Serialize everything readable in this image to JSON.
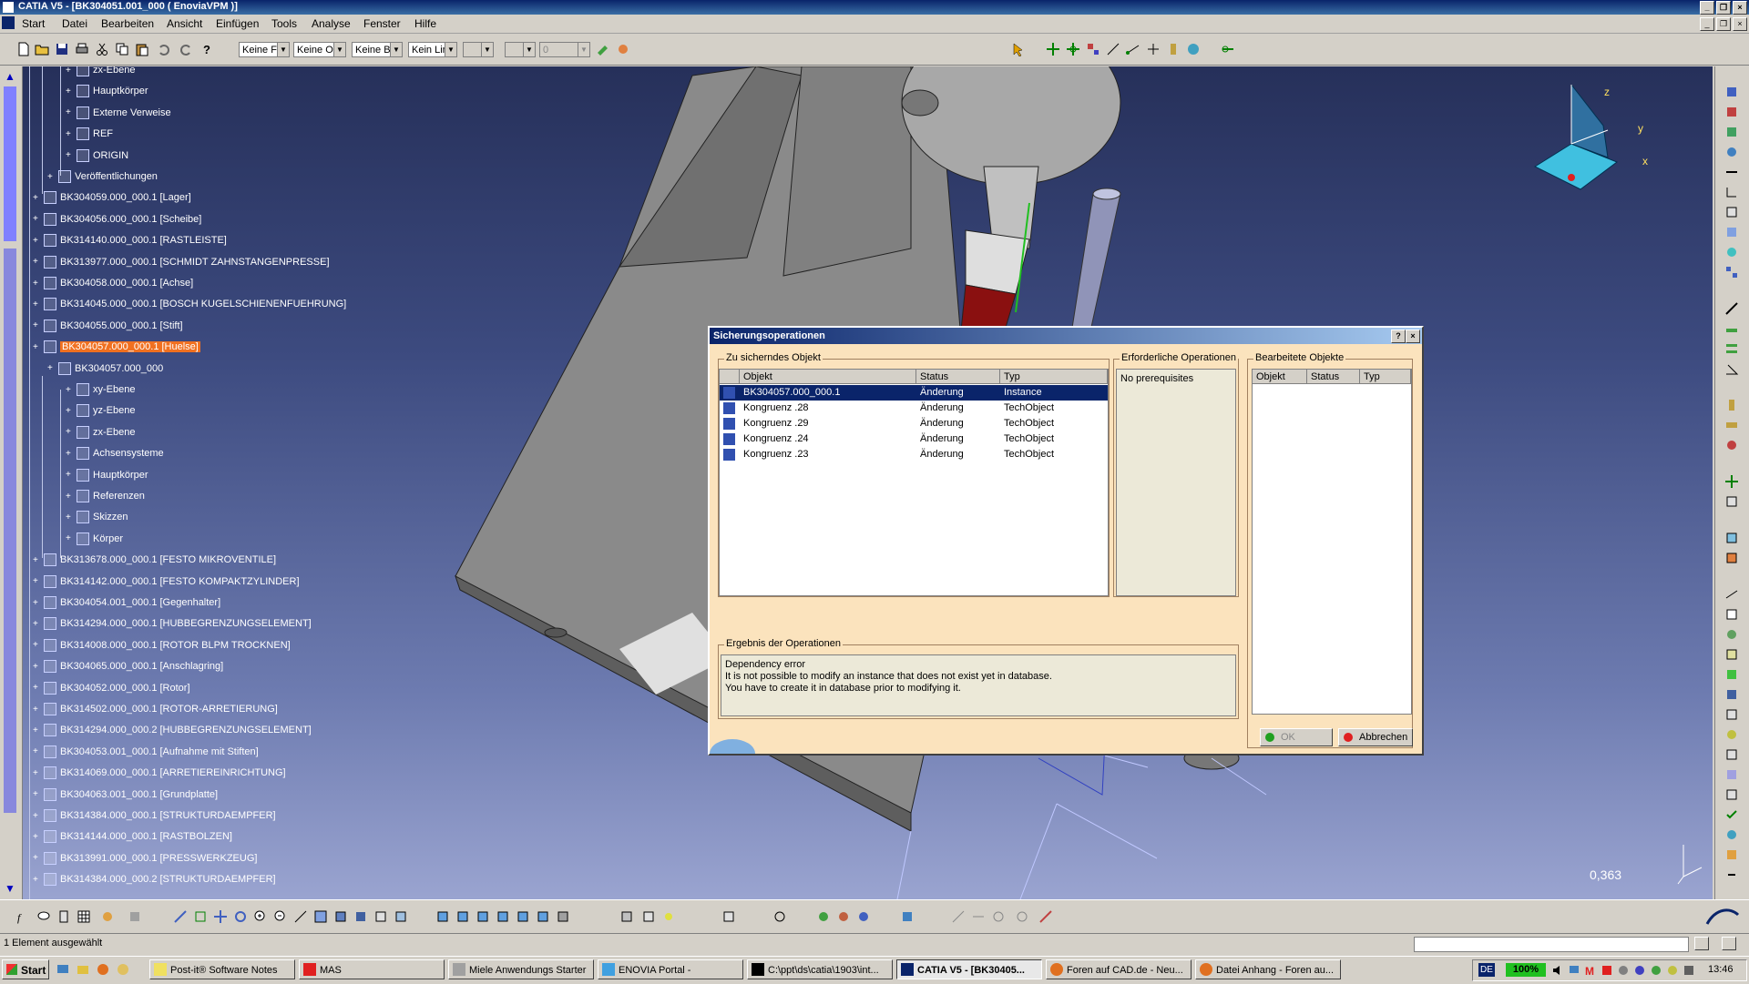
{
  "window": {
    "title": "CATIA V5 - [BK304051.001_000 ( EnoviaVPM )]"
  },
  "menu": [
    "Start",
    "Datei",
    "Bearbeiten",
    "Ansicht",
    "Einfügen",
    "Tools",
    "Analyse",
    "Fenster",
    "Hilfe"
  ],
  "toolbar": {
    "combo1": "Keine F",
    "combo2": "Keine O",
    "combo3": "Keine B",
    "combo4": "Kein Lin",
    "combo5": "0"
  },
  "tree": [
    {
      "label": "zx-Ebene",
      "level": 2
    },
    {
      "label": "Hauptkörper",
      "level": 2
    },
    {
      "label": "Externe Verweise",
      "level": 2
    },
    {
      "label": "REF",
      "level": 2
    },
    {
      "label": "ORIGIN",
      "level": 2
    },
    {
      "label": "Veröffentlichungen",
      "level": 1
    },
    {
      "label": "BK304059.000_000.1 [Lager]",
      "level": 0
    },
    {
      "label": "BK304056.000_000.1 [Scheibe]",
      "level": 0
    },
    {
      "label": "BK314140.000_000.1 [RASTLEISTE]",
      "level": 0
    },
    {
      "label": "BK313977.000_000.1 [SCHMIDT ZAHNSTANGENPRESSE]",
      "level": 0
    },
    {
      "label": "BK304058.000_000.1 [Achse]",
      "level": 0
    },
    {
      "label": "BK314045.000_000.1 [BOSCH KUGELSCHIENENFUEHRUNG]",
      "level": 0
    },
    {
      "label": "BK304055.000_000.1 [Stift]",
      "level": 0
    },
    {
      "label": "BK304057.000_000.1 [Huelse]",
      "level": 0,
      "selected": true
    },
    {
      "label": "BK304057.000_000",
      "level": 1
    },
    {
      "label": "xy-Ebene",
      "level": 2
    },
    {
      "label": "yz-Ebene",
      "level": 2
    },
    {
      "label": "zx-Ebene",
      "level": 2
    },
    {
      "label": "Achsensysteme",
      "level": 2
    },
    {
      "label": "Hauptkörper",
      "level": 2
    },
    {
      "label": "Referenzen",
      "level": 2
    },
    {
      "label": "Skizzen",
      "level": 2
    },
    {
      "label": "Körper",
      "level": 2
    },
    {
      "label": "BK313678.000_000.1 [FESTO MIKROVENTILE]",
      "level": 0
    },
    {
      "label": "BK314142.000_000.1 [FESTO KOMPAKTZYLINDER]",
      "level": 0
    },
    {
      "label": "BK304054.001_000.1 [Gegenhalter]",
      "level": 0
    },
    {
      "label": "BK314294.000_000.1 [HUBBEGRENZUNGSELEMENT]",
      "level": 0
    },
    {
      "label": "BK314008.000_000.1 [ROTOR  BLPM TROCKNEN]",
      "level": 0
    },
    {
      "label": "BK304065.000_000.1 [Anschlagring]",
      "level": 0
    },
    {
      "label": "BK304052.000_000.1 [Rotor]",
      "level": 0
    },
    {
      "label": "BK314502.000_000.1 [ROTOR-ARRETIERUNG]",
      "level": 0
    },
    {
      "label": "BK314294.000_000.2 [HUBBEGRENZUNGSELEMENT]",
      "level": 0
    },
    {
      "label": "BK304053.001_000.1 [Aufnahme mit Stiften]",
      "level": 0
    },
    {
      "label": "BK314069.000_000.1 [ARRETIEREINRICHTUNG]",
      "level": 0
    },
    {
      "label": "BK304063.001_000.1 [Grundplatte]",
      "level": 0
    },
    {
      "label": "BK314384.000_000.1 [STRUKTURDAEMPFER]",
      "level": 0
    },
    {
      "label": "BK314144.000_000.1 [RASTBOLZEN]",
      "level": 0
    },
    {
      "label": "BK313991.000_000.1 [PRESSWERKZEUG]",
      "level": 0
    },
    {
      "label": "BK314384.000_000.2 [STRUKTURDAEMPFER]",
      "level": 0
    }
  ],
  "compass": {
    "z": "z",
    "y": "y",
    "x": "x"
  },
  "viewport": {
    "scale": "0,363"
  },
  "dialog": {
    "title": "Sicherungsoperationen",
    "help": "?",
    "close": "×",
    "save_group": "Zu sicherndes Objekt",
    "columns": [
      "Objekt",
      "Status",
      "Typ"
    ],
    "rows": [
      {
        "objekt": "BK304057.000_000.1",
        "status": "Änderung",
        "typ": "Instance",
        "selected": true
      },
      {
        "objekt": "Kongruenz .28",
        "status": "Änderung",
        "typ": "TechObject"
      },
      {
        "objekt": "Kongruenz .29",
        "status": "Änderung",
        "typ": "TechObject"
      },
      {
        "objekt": "Kongruenz .24",
        "status": "Änderung",
        "typ": "TechObject"
      },
      {
        "objekt": "Kongruenz .23",
        "status": "Änderung",
        "typ": "TechObject"
      }
    ],
    "required_group": "Erforderliche Operationen",
    "required_text": "No prerequisites",
    "processed_group": "Bearbeitete Objekte",
    "processed_columns": [
      "Objekt",
      "Status",
      "Typ"
    ],
    "result_group": "Ergebnis der Operationen",
    "result_lines": [
      "Dependency error",
      "It is not possible to modify an instance that does not exist yet in database.",
      "You have to create it in database prior to modifying it."
    ],
    "ok": "OK",
    "cancel": "Abbrechen"
  },
  "status": {
    "message": "1 Element ausgewählt"
  },
  "taskbar": {
    "start": "Start",
    "tasks": [
      "Post-it® Software Notes",
      "MAS",
      "Miele Anwendungs Starter",
      "ENOVIA Portal -",
      "C:\\ppt\\ds\\catia\\1903\\int...",
      "CATIA V5 - [BK30405...",
      "Foren auf CAD.de - Neu...",
      "Datei Anhang - Foren au..."
    ],
    "lang": "DE",
    "zoom": "100%",
    "clock": "13:46"
  },
  "colors": {
    "title": "#0a246a",
    "selection": "#f07020",
    "dialog_bg": "#fbe3bd"
  }
}
